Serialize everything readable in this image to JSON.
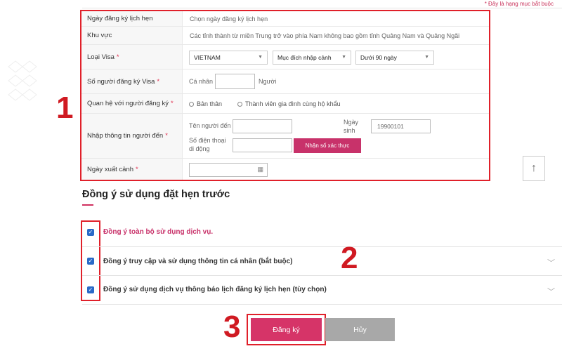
{
  "required_note": "* Đây là hạng mục bắt buộc",
  "form": {
    "appointment_date": {
      "label": "Ngày đăng ký lịch hẹn",
      "value": "Chọn ngày đăng ký lịch hẹn"
    },
    "region": {
      "label": "Khu vực",
      "value": "Các tỉnh thành từ miền Trung trở vào phía Nam không bao gồm tỉnh Quảng Nam và Quảng Ngãi"
    },
    "visa_type": {
      "label": "Loại Visa",
      "nationality": "VIETNAM",
      "purpose": "Mục đích nhập cảnh",
      "duration": "Dưới 90 ngày"
    },
    "applicants": {
      "label": "Số người đăng ký Visa",
      "prefix": "Cá nhân",
      "value": "",
      "suffix": "Người"
    },
    "relationship": {
      "label": "Quan hệ với người đăng ký",
      "option_self": "Bản thân",
      "option_family": "Thành viên gia đình cùng hộ khẩu"
    },
    "person_info": {
      "label": "Nhập thông tin người đến",
      "name_label": "Tên người đến",
      "name_value": "",
      "dob_label": "Ngày sinh",
      "dob_placeholder": "19900101",
      "phone_label": "Số điện thoại di động",
      "phone_value": "",
      "verify_button": "Nhận số xác thực"
    },
    "departure": {
      "label": "Ngày xuất cảnh",
      "value": ""
    }
  },
  "annotations": {
    "step1": "1",
    "step2": "2",
    "step3": "3"
  },
  "scroll_top_icon": "arrow-up-icon",
  "agreement": {
    "title": "Đồng ý sử dụng đặt hẹn trước",
    "items": [
      {
        "label": "Đồng ý toàn bộ sử dụng dịch vụ.",
        "checked": true
      },
      {
        "label": "Đồng ý truy cập và sử dụng thông tin cá nhân (bắt buộc)",
        "checked": true
      },
      {
        "label": "Đồng ý sử dụng dịch vụ thông báo lịch đăng ký lịch hẹn (tùy chọn)",
        "checked": true
      }
    ]
  },
  "buttons": {
    "submit": "Đăng ký",
    "cancel": "Hủy"
  },
  "colors": {
    "annotation_red": "#e0202a",
    "brand_pink": "#d63468",
    "checkbox_blue": "#2a6ac8",
    "cancel_gray": "#a8a8a8"
  }
}
